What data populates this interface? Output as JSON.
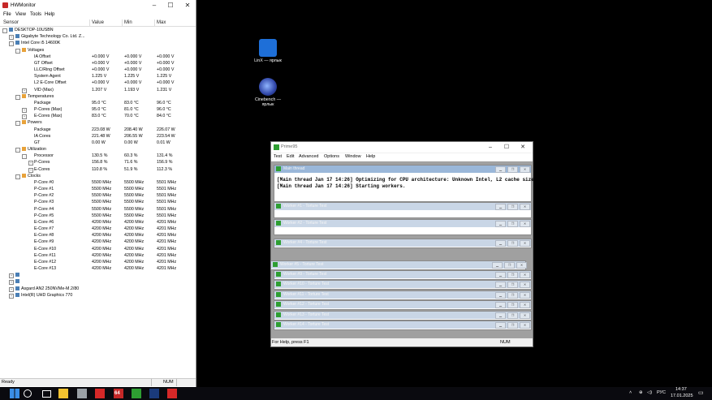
{
  "hwmonitor": {
    "title": "HWMonitor",
    "menu": [
      "File",
      "View",
      "Tools",
      "Help"
    ],
    "columns": {
      "sensor": "Sensor",
      "value": "Value",
      "min": "Min",
      "max": "Max"
    },
    "rows": [
      {
        "indent": 0,
        "exp": "-",
        "label": "DESKTOP-10USBN",
        "value": "",
        "min": "",
        "max": ""
      },
      {
        "indent": 1,
        "exp": "+",
        "label": "Gigabyte Technology Co. Ltd. Z...",
        "value": "",
        "min": "",
        "max": ""
      },
      {
        "indent": 1,
        "exp": "-",
        "label": "Intel Core i5 14600K",
        "value": "",
        "min": "",
        "max": ""
      },
      {
        "indent": 2,
        "exp": "-",
        "label": "Voltages",
        "value": "",
        "min": "",
        "max": ""
      },
      {
        "indent": 4,
        "exp": "",
        "label": "IA Offset",
        "value": "+0.000 V",
        "min": "+0.000 V",
        "max": "+0.000 V"
      },
      {
        "indent": 4,
        "exp": "",
        "label": "GT Offset",
        "value": "+0.000 V",
        "min": "+0.000 V",
        "max": "+0.000 V"
      },
      {
        "indent": 4,
        "exp": "",
        "label": "LLC/Ring Offset",
        "value": "+0.000 V",
        "min": "+0.000 V",
        "max": "+0.000 V"
      },
      {
        "indent": 4,
        "exp": "",
        "label": "System Agent",
        "value": "1.225 V",
        "min": "1.225 V",
        "max": "1.225 V"
      },
      {
        "indent": 4,
        "exp": "",
        "label": "L2 E-Core Offset",
        "value": "+0.000 V",
        "min": "+0.000 V",
        "max": "+0.000 V"
      },
      {
        "indent": 3,
        "exp": "+",
        "label": "VID (Max)",
        "value": "1.207 V",
        "min": "1.193 V",
        "max": "1.231 V"
      },
      {
        "indent": 2,
        "exp": "-",
        "label": "Temperatures",
        "value": "",
        "min": "",
        "max": ""
      },
      {
        "indent": 4,
        "exp": "",
        "label": "Package",
        "value": "95.0 °C",
        "min": "83.0 °C",
        "max": "96.0 °C"
      },
      {
        "indent": 3,
        "exp": "+",
        "label": "P-Cores (Max)",
        "value": "95.0 °C",
        "min": "81.0 °C",
        "max": "96.0 °C"
      },
      {
        "indent": 3,
        "exp": "+",
        "label": "E-Cores (Max)",
        "value": "83.0 °C",
        "min": "70.0 °C",
        "max": "84.0 °C"
      },
      {
        "indent": 2,
        "exp": "-",
        "label": "Powers",
        "value": "",
        "min": "",
        "max": ""
      },
      {
        "indent": 4,
        "exp": "",
        "label": "Package",
        "value": "223.08 W",
        "min": "208.40 W",
        "max": "226.07 W"
      },
      {
        "indent": 4,
        "exp": "",
        "label": "IA Cores",
        "value": "221.48 W",
        "min": "206.55 W",
        "max": "223.54 W"
      },
      {
        "indent": 4,
        "exp": "",
        "label": "GT",
        "value": "0.00 W",
        "min": "0.00 W",
        "max": "0.01 W"
      },
      {
        "indent": 2,
        "exp": "-",
        "label": "Utilization",
        "value": "",
        "min": "",
        "max": ""
      },
      {
        "indent": 3,
        "exp": "-",
        "label": "Processor",
        "value": "130.5 %",
        "min": "60.3 %",
        "max": "131.4 %"
      },
      {
        "indent": 4,
        "exp": "+",
        "label": "P-Cores",
        "value": "156.8 %",
        "min": "71.6 %",
        "max": "156.9 %"
      },
      {
        "indent": 4,
        "exp": "+",
        "label": "E-Cores",
        "value": "110.8 %",
        "min": "51.9 %",
        "max": "112.3 %"
      },
      {
        "indent": 2,
        "exp": "-",
        "label": "Clocks",
        "value": "",
        "min": "",
        "max": ""
      },
      {
        "indent": 4,
        "exp": "",
        "label": "P-Core #0",
        "value": "5500 MHz",
        "min": "5500 MHz",
        "max": "5501 MHz"
      },
      {
        "indent": 4,
        "exp": "",
        "label": "P-Core #1",
        "value": "5500 MHz",
        "min": "5500 MHz",
        "max": "5501 MHz"
      },
      {
        "indent": 4,
        "exp": "",
        "label": "P-Core #2",
        "value": "5500 MHz",
        "min": "5500 MHz",
        "max": "5501 MHz"
      },
      {
        "indent": 4,
        "exp": "",
        "label": "P-Core #3",
        "value": "5500 MHz",
        "min": "5500 MHz",
        "max": "5501 MHz"
      },
      {
        "indent": 4,
        "exp": "",
        "label": "P-Core #4",
        "value": "5500 MHz",
        "min": "5500 MHz",
        "max": "5501 MHz"
      },
      {
        "indent": 4,
        "exp": "",
        "label": "P-Core #5",
        "value": "5500 MHz",
        "min": "5500 MHz",
        "max": "5501 MHz"
      },
      {
        "indent": 4,
        "exp": "",
        "label": "E-Core #6",
        "value": "4200 MHz",
        "min": "4200 MHz",
        "max": "4201 MHz"
      },
      {
        "indent": 4,
        "exp": "",
        "label": "E-Core #7",
        "value": "4200 MHz",
        "min": "4200 MHz",
        "max": "4201 MHz"
      },
      {
        "indent": 4,
        "exp": "",
        "label": "E-Core #8",
        "value": "4200 MHz",
        "min": "4200 MHz",
        "max": "4201 MHz"
      },
      {
        "indent": 4,
        "exp": "",
        "label": "E-Core #9",
        "value": "4200 MHz",
        "min": "4200 MHz",
        "max": "4201 MHz"
      },
      {
        "indent": 4,
        "exp": "",
        "label": "E-Core #10",
        "value": "4200 MHz",
        "min": "4200 MHz",
        "max": "4201 MHz"
      },
      {
        "indent": 4,
        "exp": "",
        "label": "E-Core #11",
        "value": "4200 MHz",
        "min": "4200 MHz",
        "max": "4201 MHz"
      },
      {
        "indent": 4,
        "exp": "",
        "label": "E-Core #12",
        "value": "4200 MHz",
        "min": "4200 MHz",
        "max": "4201 MHz"
      },
      {
        "indent": 4,
        "exp": "",
        "label": "E-Core #13",
        "value": "4200 MHz",
        "min": "4200 MHz",
        "max": "4201 MHz"
      },
      {
        "indent": 1,
        "exp": "+",
        "label": "",
        "value": "",
        "min": "",
        "max": ""
      },
      {
        "indent": 1,
        "exp": "+",
        "label": "",
        "value": "",
        "min": "",
        "max": ""
      },
      {
        "indent": 1,
        "exp": "+",
        "label": "Asgard AN2 250NVMe-M.2/80",
        "value": "",
        "min": "",
        "max": ""
      },
      {
        "indent": 1,
        "exp": "+",
        "label": "Intel(R) UHD Graphics 770",
        "value": "",
        "min": "",
        "max": ""
      }
    ],
    "status_left": "Ready",
    "status_num": "NUM"
  },
  "desktop_icons": [
    {
      "label": "LinX — ярлык",
      "color": "#1e6fd8"
    },
    {
      "label": "Cinebench — ярлык",
      "color": "#2a3a8a"
    }
  ],
  "prime95": {
    "title": "Prime95",
    "menu": [
      "Test",
      "Edit",
      "Advanced",
      "Options",
      "Window",
      "Help"
    ],
    "main_thread_title": "Main thread",
    "log_lines": [
      "[Main thread Jan 17 14:26] Optimizing for CPU architecture: Unknown Intel, L2 cache size: 8x2560 KB, L3",
      "[Main thread Jan 17 14:26] Starting workers."
    ],
    "workers": [
      "Worker #1 - Torture Test",
      "Worker #2 - Torture Test",
      "Worker #4 - Torture Test",
      "Worker #5 - Torture Test",
      "Worker #9 - Torture Test",
      "Worker #10 - Torture Test",
      "Worker #11 - Torture Test",
      "Worker #12 - Torture Test",
      "Worker #13 - Torture Test",
      "Worker #14 - Torture Test"
    ],
    "status_left": "For Help, press F1",
    "status_num": "NUM"
  },
  "taskbar": {
    "lang": "РУС",
    "time": "14:37",
    "date": "17.01.2025",
    "apps": [
      {
        "name": "windows-logo",
        "color": "#3a8ee6"
      },
      {
        "name": "search",
        "color": "#ffffff"
      },
      {
        "name": "task-view",
        "color": "#ffffff"
      },
      {
        "name": "file-explorer",
        "color": "#f2c230"
      },
      {
        "name": "gear-app",
        "color": "#9aa0a6"
      },
      {
        "name": "red-app",
        "color": "#d62828"
      },
      {
        "name": "aida64",
        "color": "#c62828"
      },
      {
        "name": "prime95",
        "color": "#2e9e32"
      },
      {
        "name": "hwmonitor",
        "color": "#1a3a7a"
      },
      {
        "name": "red-app-2",
        "color": "#d62828"
      }
    ],
    "app_text": {
      "aida64": "64"
    }
  }
}
